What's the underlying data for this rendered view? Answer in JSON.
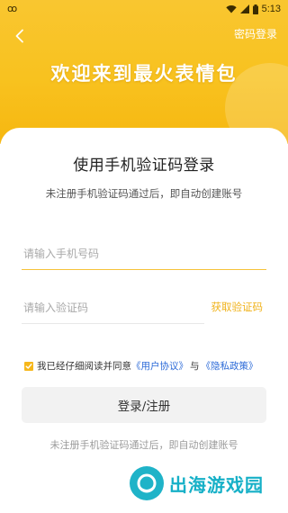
{
  "status_bar": {
    "left_icon": "ꝏ",
    "time": "5:13"
  },
  "header": {
    "back_icon": "chevron-left-icon",
    "password_login": "密码登录",
    "welcome_title": "欢迎来到最火表情包"
  },
  "form": {
    "title": "使用手机验证码登录",
    "subtitle": "未注册手机验证码通过后，即自动创建账号",
    "phone_placeholder": "请输入手机号码",
    "code_placeholder": "请输入验证码",
    "get_code": "获取验证码",
    "agreement": {
      "checked": true,
      "prefix": "我已经仔细阅读并同意",
      "user_agreement": "《用户协议》",
      "and": "与",
      "privacy_policy": "《隐私政策》"
    },
    "login_button": "登录/注册",
    "bottom_note": "未注册手机验证码通过后，即自动创建账号"
  },
  "watermark": {
    "text": "出海游戏园"
  },
  "colors": {
    "brand_yellow": "#f8c21f",
    "link_blue": "#2d6bd8",
    "get_code_orange": "#f0b21a"
  }
}
